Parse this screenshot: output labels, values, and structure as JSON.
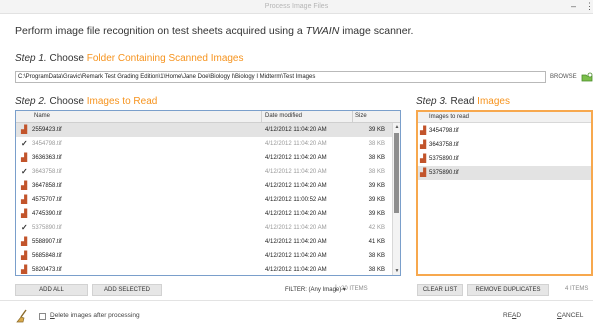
{
  "window": {
    "title": "Process Image Files",
    "minimize": "–",
    "more": "⋮"
  },
  "intro": {
    "prefix": "Perform image file recognition  on test sheets acquired using a ",
    "emphasis": "TWAIN",
    "suffix": " image scanner."
  },
  "step1": {
    "num": "Step 1.",
    "label": " Choose ",
    "highlight": "Folder Containing Scanned Images",
    "path": "C:\\ProgramData\\Gravic\\Remark Test Grading Edition\\1\\Home\\Jane Doe\\Biology I\\Biology I Midterm\\Test Images",
    "browse_label": "BROWSE"
  },
  "step2": {
    "num": "Step 2.",
    "label": " Choose ",
    "highlight": "Images to Read",
    "columns": {
      "name": "Name",
      "date": "Date modified",
      "size": "Size"
    },
    "rows": [
      {
        "icon": "image",
        "name": "2559423.tif",
        "date": "4/12/2012 11:04:20 AM",
        "size": "39 KB",
        "selected": true,
        "muted": false
      },
      {
        "icon": "check",
        "name": "3454798.tif",
        "date": "4/12/2012 11:04:20 AM",
        "size": "38 KB",
        "selected": false,
        "muted": true
      },
      {
        "icon": "image",
        "name": "3636363.tif",
        "date": "4/12/2012 11:04:20 AM",
        "size": "38 KB",
        "selected": false,
        "muted": false
      },
      {
        "icon": "check",
        "name": "3643758.tif",
        "date": "4/12/2012 11:04:20 AM",
        "size": "38 KB",
        "selected": false,
        "muted": true
      },
      {
        "icon": "image",
        "name": "3647858.tif",
        "date": "4/12/2012 11:04:20 AM",
        "size": "39 KB",
        "selected": false,
        "muted": false
      },
      {
        "icon": "image",
        "name": "4575707.tif",
        "date": "4/12/2012 11:00:52 AM",
        "size": "39 KB",
        "selected": false,
        "muted": false
      },
      {
        "icon": "image",
        "name": "4745390.tif",
        "date": "4/12/2012 11:04:20 AM",
        "size": "39 KB",
        "selected": false,
        "muted": false
      },
      {
        "icon": "check",
        "name": "5375890.tif",
        "date": "4/12/2012 11:04:20 AM",
        "size": "42 KB",
        "selected": false,
        "muted": true
      },
      {
        "icon": "image",
        "name": "5588907.tif",
        "date": "4/12/2012 11:04:20 AM",
        "size": "41 KB",
        "selected": false,
        "muted": false
      },
      {
        "icon": "image",
        "name": "5685848.tif",
        "date": "4/12/2012 11:04:20 AM",
        "size": "38 KB",
        "selected": false,
        "muted": false
      },
      {
        "icon": "image",
        "name": "5820473.tif",
        "date": "4/12/2012 11:04:20 AM",
        "size": "38 KB",
        "selected": false,
        "muted": false
      }
    ],
    "add_all": "ADD ALL",
    "add_selected": "ADD SELECTED",
    "filter_label": "FILTER: (Any Image)",
    "filter_caret": "▾",
    "separator": "|",
    "count": "20 ITEMS"
  },
  "step3": {
    "num": "Step 3.",
    "label": " Read ",
    "highlight": "Images",
    "column": "Images to read",
    "rows": [
      {
        "name": "3454798.tif",
        "selected": false
      },
      {
        "name": "3643758.tif",
        "selected": false
      },
      {
        "name": "5375890.tif",
        "selected": false
      },
      {
        "name": "5375890.tif",
        "selected": true
      }
    ],
    "clear_list": "CLEAR LIST",
    "remove_duplicates": "REMOVE DUPLICATES",
    "count": "4 ITEMS"
  },
  "footer": {
    "delete_ul": "D",
    "delete_rest": "elete images after processing",
    "delete_checked": false,
    "read_pre": "RE",
    "read_ul": "A",
    "read_post": "D",
    "cancel_ul": "C",
    "cancel_rest": "ANCEL"
  },
  "colors": {
    "accent_orange": "#f6931d",
    "selected_row": "#e3e3e3",
    "list_border": "#7a9fcb",
    "image_icon": "#c2542b"
  }
}
